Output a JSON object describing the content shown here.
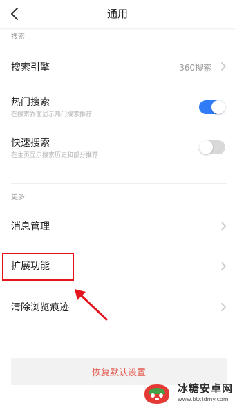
{
  "header": {
    "title": "通用",
    "back_icon": "chevron-left-icon"
  },
  "sections": {
    "search": {
      "label": "搜索",
      "engine": {
        "label": "搜索引擎",
        "value": "360搜索"
      },
      "hot_search": {
        "label": "热门搜索",
        "sublabel": "在搜索界面显示热门搜索推荐",
        "enabled": true
      },
      "quick_search": {
        "label": "快速搜索",
        "sublabel": "在主页显示搜索历史和部分推荐",
        "enabled": false
      }
    },
    "more": {
      "label": "更多",
      "items": [
        {
          "label": "消息管理"
        },
        {
          "label": "扩展功能"
        },
        {
          "label": "清除浏览痕迹"
        }
      ]
    }
  },
  "reset_button": {
    "label": "恢复默认设置"
  },
  "annotation": {
    "highlighted_item": "扩展功能",
    "color": "#e3141b"
  },
  "colors": {
    "toggle_on": "#2f7cf6",
    "toggle_off": "#d9d9d9",
    "accent_red": "#e45a4f"
  },
  "watermark": {
    "name": "冰糖安卓网",
    "url": "www.btxtdmy.com"
  }
}
